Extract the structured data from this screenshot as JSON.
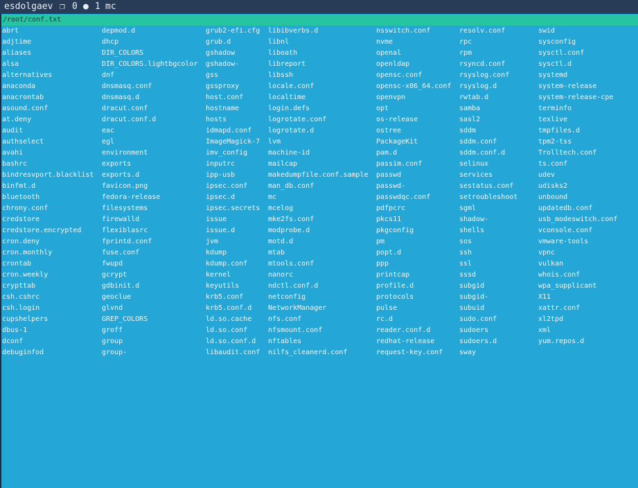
{
  "titlebar": {
    "host": "esdolgaev",
    "window_icon": "window-icon",
    "window_num": "0",
    "active_dot": "●",
    "session_num": "1",
    "program": "mc"
  },
  "path": "/root/conf.txt",
  "colors": {
    "background": "#24a7d6",
    "titlebar": "#283b57",
    "pathbar": "#27c4a2",
    "text": "#eaf7fc"
  },
  "columns": [
    [
      "abrt",
      "adjtime",
      "aliases",
      "alsa",
      "alternatives",
      "anaconda",
      "anacrontab",
      "asound.conf",
      "at.deny",
      "audit",
      "authselect",
      "avahi",
      "bashrc",
      "bindresvport.blacklist",
      "binfmt.d",
      "bluetooth",
      "chrony.conf",
      "credstore",
      "credstore.encrypted",
      "cron.deny",
      "cron.monthly",
      "crontab",
      "cron.weekly",
      "crypttab",
      "csh.cshrc",
      "csh.login",
      "cupshelpers",
      "dbus-1",
      "dconf",
      "debuginfod"
    ],
    [
      "depmod.d",
      "dhcp",
      "DIR_COLORS",
      "DIR_COLORS.lightbgcolor",
      "dnf",
      "dnsmasq.conf",
      "dnsmasq.d",
      "dracut.conf",
      "dracut.conf.d",
      "eac",
      "egl",
      "environment",
      "exports",
      "exports.d",
      "favicon.png",
      "fedora-release",
      "filesystems",
      "firewalld",
      "flexiblasrc",
      "fprintd.conf",
      "fuse.conf",
      "fwupd",
      "gcrypt",
      "gdbinit.d",
      "geoclue",
      "glvnd",
      "GREP_COLORS",
      "groff",
      "group",
      "group-"
    ],
    [
      "grub2-efi.cfg",
      "grub.d",
      "gshadow",
      "gshadow-",
      "gss",
      "gssproxy",
      "host.conf",
      "hostname",
      "hosts",
      "idmapd.conf",
      "ImageMagick-7",
      "imv_config",
      "inputrc",
      "ipp-usb",
      "ipsec.conf",
      "ipsec.d",
      "ipsec.secrets",
      "issue",
      "issue.d",
      "jvm",
      "kdump",
      "kdump.conf",
      "kernel",
      "keyutils",
      "krb5.conf",
      "krb5.conf.d",
      "ld.so.cache",
      "ld.so.conf",
      "ld.so.conf.d",
      "libaudit.conf"
    ],
    [
      "libibverbs.d",
      "libnl",
      "liboath",
      "libreport",
      "libssh",
      "locale.conf",
      "localtime",
      "login.defs",
      "logrotate.conf",
      "logrotate.d",
      "lvm",
      "machine-id",
      "mailcap",
      "makedumpfile.conf.sample",
      "man_db.conf",
      "mc",
      "mcelog",
      "mke2fs.conf",
      "modprobe.d",
      "motd.d",
      "mtab",
      "mtools.conf",
      "nanorc",
      "ndctl.conf.d",
      "netconfig",
      "NetworkManager",
      "nfs.conf",
      "nfsmount.conf",
      "nftables",
      "nilfs_cleanerd.conf"
    ],
    [
      "nsswitch.conf",
      "nvme",
      "openal",
      "openldap",
      "opensc.conf",
      "opensc-x86_64.conf",
      "openvpn",
      "opt",
      "os-release",
      "ostree",
      "PackageKit",
      "pam.d",
      "passim.conf",
      "passwd",
      "passwd-",
      "passwdqc.conf",
      "pdfpcrc",
      "pkcs11",
      "pkgconfig",
      "pm",
      "popt.d",
      "ppp",
      "printcap",
      "profile.d",
      "protocols",
      "pulse",
      "rc.d",
      "reader.conf.d",
      "redhat-release",
      "request-key.conf"
    ],
    [
      "resolv.conf",
      "rpc",
      "rpm",
      "rsyncd.conf",
      "rsyslog.conf",
      "rsyslog.d",
      "rwtab.d",
      "samba",
      "sasl2",
      "sddm",
      "sddm.conf",
      "sddm.conf.d",
      "selinux",
      "services",
      "sestatus.conf",
      "setroubleshoot",
      "sgml",
      "shadow-",
      "shells",
      "sos",
      "ssh",
      "ssl",
      "sssd",
      "subgid",
      "subgid-",
      "subuid",
      "sudo.conf",
      "sudoers",
      "sudoers.d",
      "sway"
    ],
    [
      "swid",
      "sysconfig",
      "sysctl.conf",
      "sysctl.d",
      "systemd",
      "system-release",
      "system-release-cpe",
      "terminfo",
      "texlive",
      "tmpfiles.d",
      "tpm2-tss",
      "Trolltech.conf",
      "ts.conf",
      "udev",
      "udisks2",
      "unbound",
      "updatedb.conf",
      "usb_modeswitch.conf",
      "vconsole.conf",
      "vmware-tools",
      "vpnc",
      "vulkan",
      "whois.conf",
      "wpa_supplicant",
      "X11",
      "xattr.conf",
      "xl2tpd",
      "xml",
      "yum.repos.d"
    ]
  ]
}
